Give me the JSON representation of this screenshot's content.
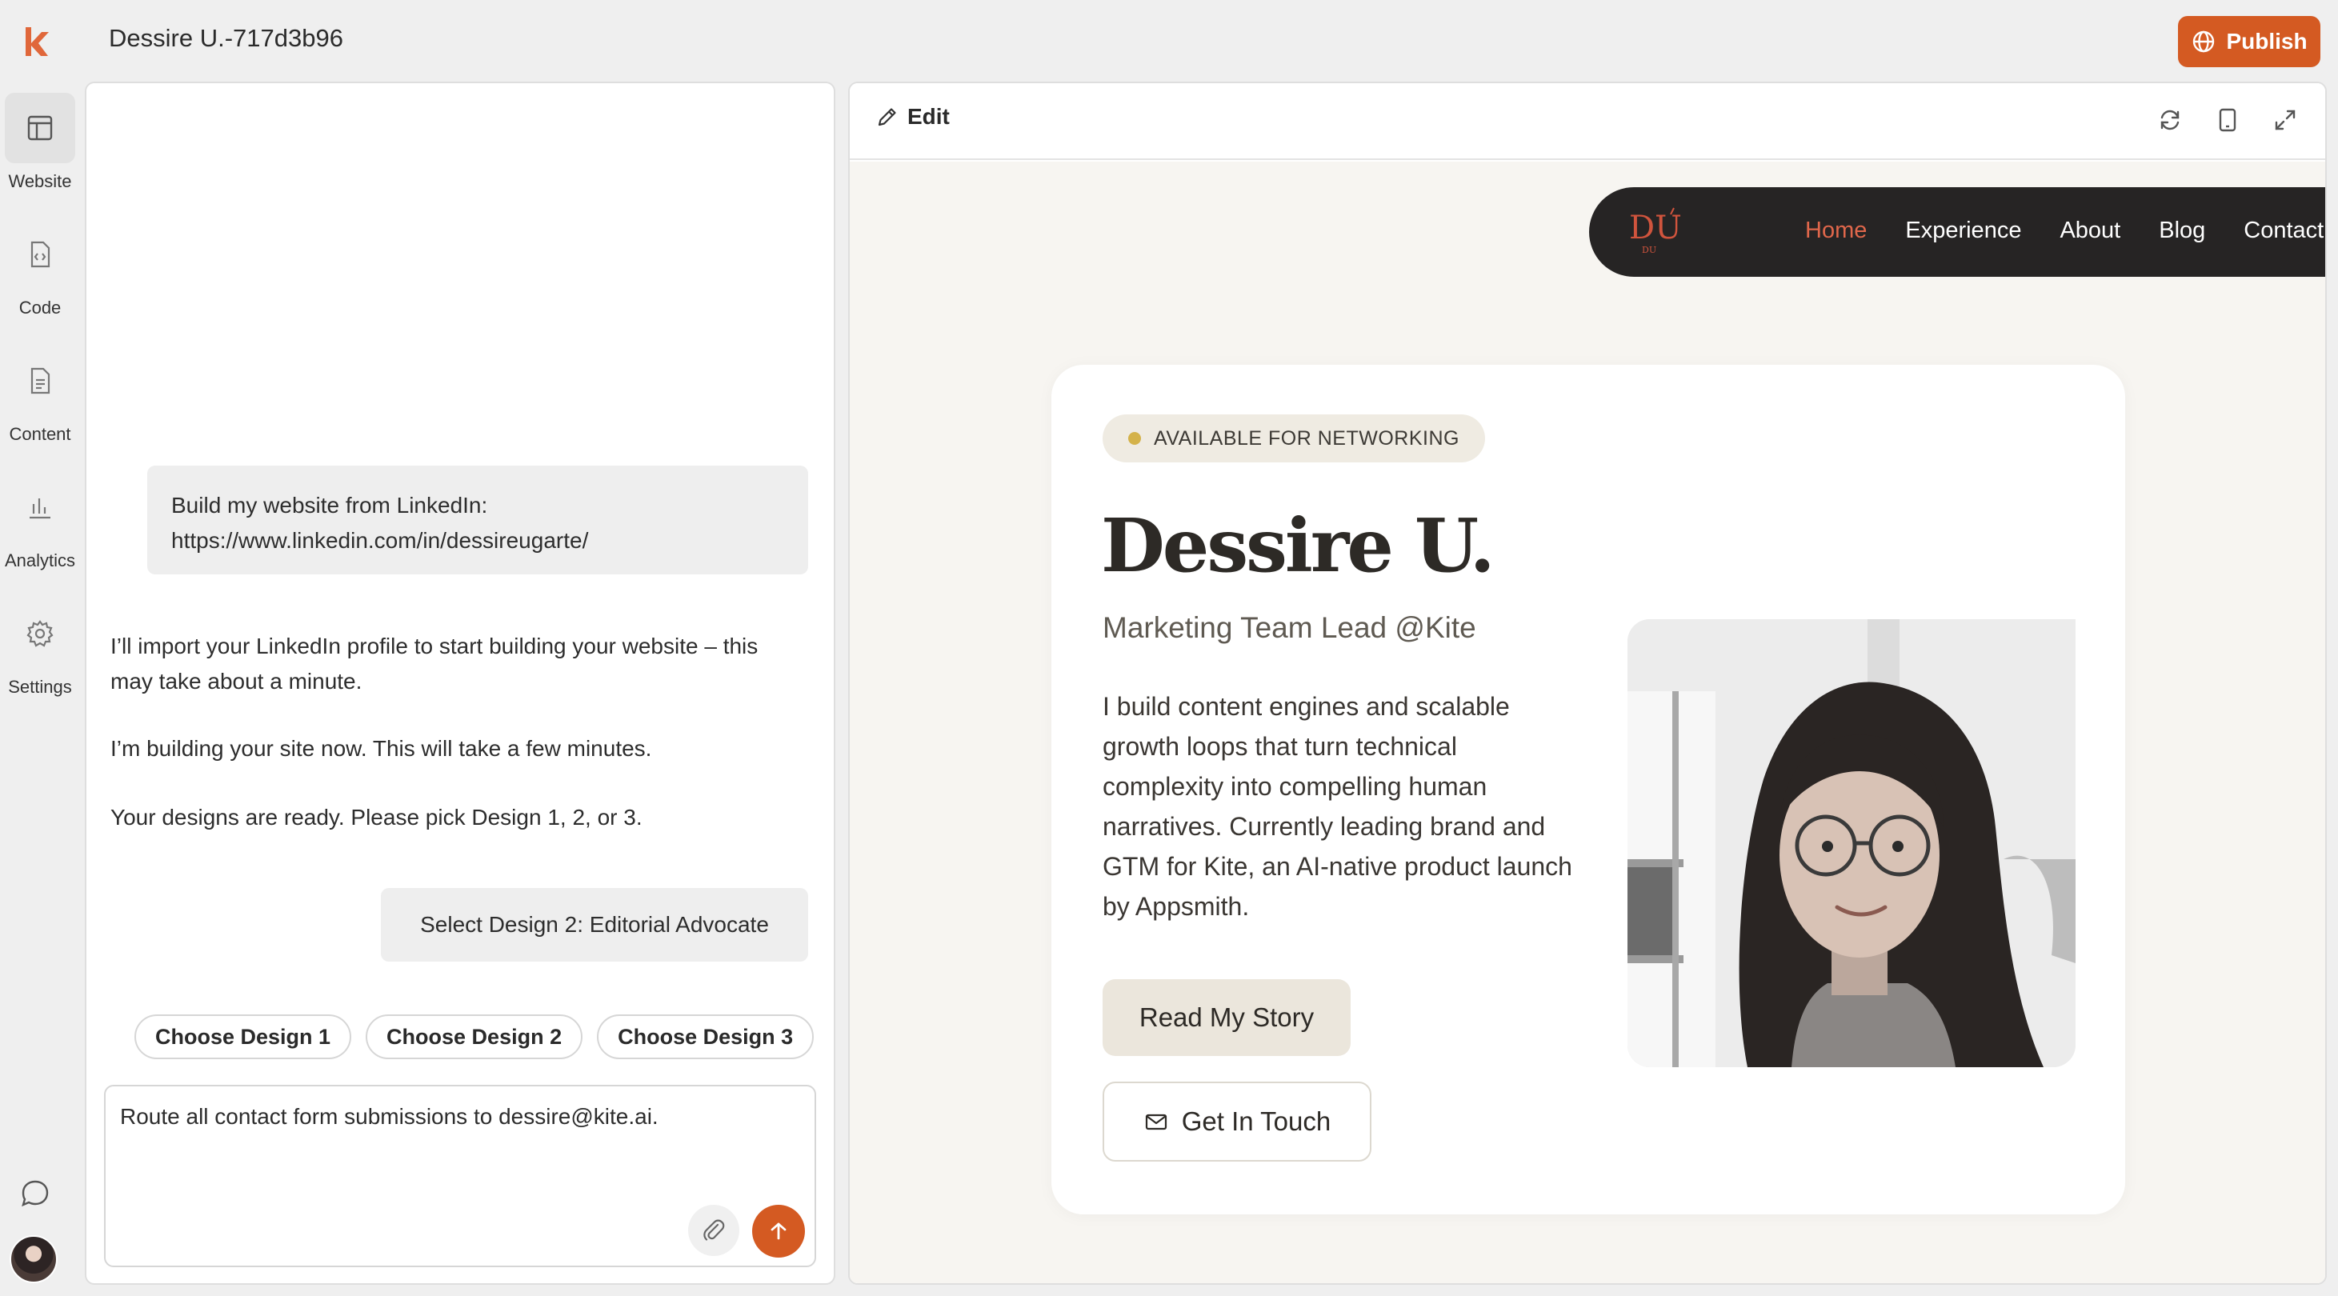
{
  "app": {
    "title": "Dessire U.-717d3b96",
    "publish_label": "Publish",
    "accent_color": "#d45a22"
  },
  "rail": {
    "items": [
      {
        "label": "Website",
        "icon": "layout-icon",
        "active": true
      },
      {
        "label": "Code",
        "icon": "code-file-icon"
      },
      {
        "label": "Content",
        "icon": "document-icon"
      },
      {
        "label": "Analytics",
        "icon": "bar-chart-icon"
      },
      {
        "label": "Settings",
        "icon": "gear-icon"
      }
    ],
    "bottom_icons": [
      "chat-icon",
      "avatar"
    ]
  },
  "chat": {
    "user_message_1": "Build my website from LinkedIn: https://www.linkedin.com/in/dessireugarte/",
    "assistant_1": "I’ll import your LinkedIn profile to start building your website – this may take about a minute.",
    "assistant_2": "I’m building your site now. This will take a few minutes.",
    "assistant_3": "Your designs are ready. Please pick Design 1, 2, or 3.",
    "user_message_2": "Select Design 2: Editorial Advocate",
    "chips": [
      "Choose Design 1",
      "Choose Design 2",
      "Choose Design 3"
    ],
    "composer_value": "Route all contact form submissions to dessire@kite.ai."
  },
  "preview": {
    "edit_label": "Edit",
    "toolbar_icons": [
      "refresh-icon",
      "tablet-icon",
      "expand-icon"
    ],
    "site": {
      "logo_text": "DU",
      "nav": [
        "Home",
        "Experience",
        "About",
        "Blog",
        "Contact"
      ],
      "nav_active": "Home",
      "badge": "AVAILABLE FOR NETWORKING",
      "name": "Dessire U.",
      "role": "Marketing Team Lead @Kite",
      "bio": "I build content engines and scalable growth loops that turn technical complexity into compelling human narratives. Currently leading brand and GTM for Kite, an AI-native product launch by Appsmith.",
      "primary_cta": "Read My Story",
      "secondary_cta": "Get In Touch",
      "nav_active_color": "#e0674b"
    }
  }
}
